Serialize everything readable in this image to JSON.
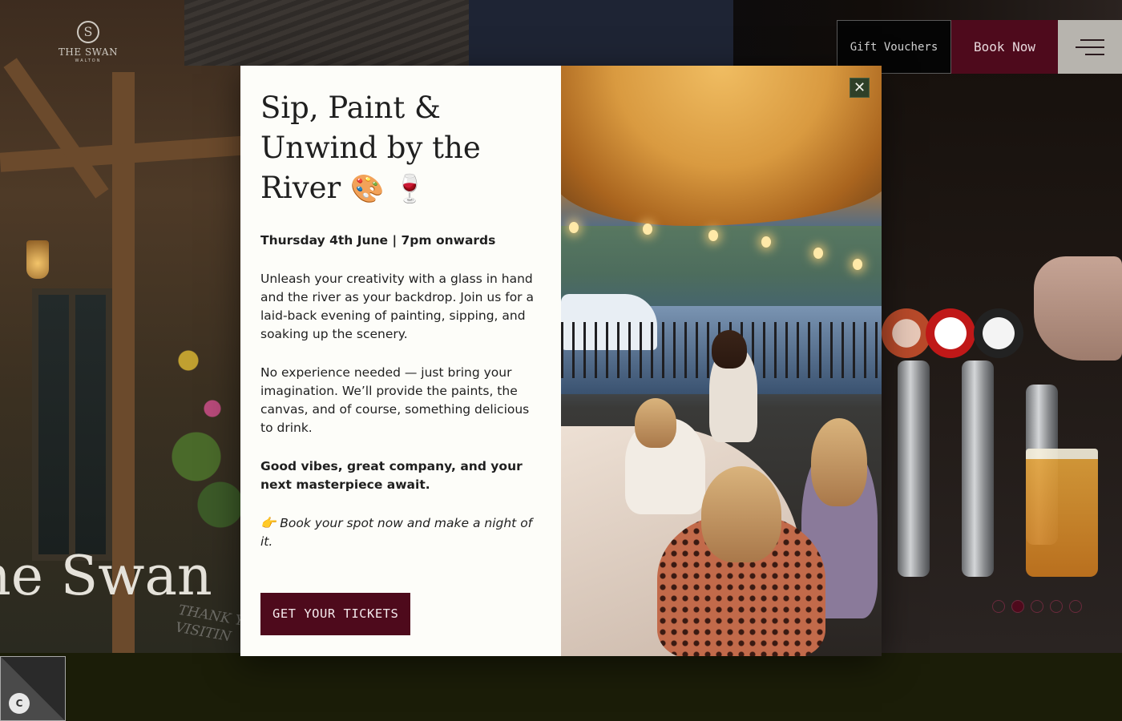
{
  "header": {
    "logo_monogram": "S",
    "logo_name": "THE SWAN",
    "logo_sub": "WALTON",
    "gift_vouchers_label": "Gift Vouchers",
    "book_now_label": "Book Now",
    "menu_icon": "hamburger-icon"
  },
  "hero": {
    "title": "he Swan",
    "chalkboard_text": "THANK YOU\nVISITIN",
    "slider": {
      "count": 5,
      "active_index": 1
    }
  },
  "modal": {
    "title": "Sip, Paint & Unwind by the River",
    "title_emojis": "🎨 🍷",
    "date_line": "Thursday 4th June | 7pm onwards",
    "para1": "Unleash your creativity with a glass in hand and the river as your backdrop. Join us for a laid-back evening of painting, sipping, and soaking up the scenery.",
    "para2": "No experience needed — just bring your imagination. We’ll provide the paints, the canvas, and of course, something delicious to drink.",
    "para3": "Good vibes, great company, and your next masterpiece await.",
    "para4_emoji": "👉",
    "para4": "Book your spot now and make a night of it.",
    "cta_label": "GET YOUR TICKETS",
    "close_label": "✕"
  },
  "cookie": {
    "icon": "cookie-settings-icon",
    "glyph": "C"
  },
  "colors": {
    "brand_burgundy": "#4e0a1c",
    "footer_olive": "#1b1d08",
    "modal_bg": "#fdfdf9",
    "close_green": "#2e4028"
  }
}
